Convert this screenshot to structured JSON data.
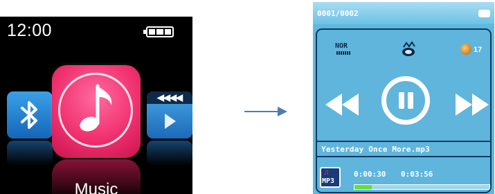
{
  "left_screen": {
    "time": "12:00",
    "battery_level": 1.0,
    "focused_item": {
      "label": "Music",
      "icon": "music-note-icon",
      "color": "#f0316f"
    },
    "side_items": [
      {
        "icon": "bluetooth-icon",
        "position": "left"
      },
      {
        "icon": "video-icon",
        "position": "right"
      }
    ]
  },
  "transition": {
    "icon": "arrow-right-icon"
  },
  "right_screen": {
    "track_counter": "0001/0002",
    "battery_level": 1.0,
    "eq_mode": "NOR",
    "repeat_icon": "repeat-icon",
    "volume": "17",
    "controls": [
      "rewind-icon",
      "pause-icon",
      "fast-forward-icon"
    ],
    "track_title": "Yesterday Once More.mp3",
    "format": "MP3",
    "elapsed_time": "0:00:30",
    "total_time": "0:03:56",
    "progress": 0.127,
    "colors": {
      "background": "#5fb8dd",
      "outline": "#0c3a63",
      "progress": "#5fe040"
    }
  }
}
